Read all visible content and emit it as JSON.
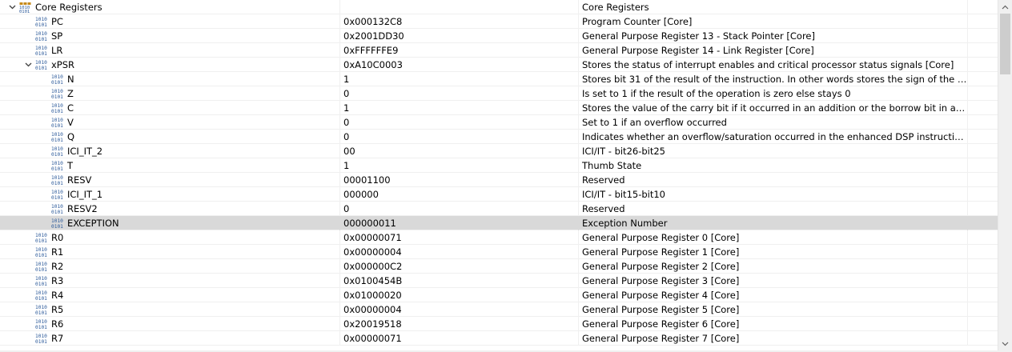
{
  "tree": {
    "rows": [
      {
        "name": "Core Registers",
        "value": "",
        "description": "Core Registers",
        "level": 0,
        "expander": "expanded",
        "icon": "register-group-icon"
      },
      {
        "name": "PC",
        "value": "0x000132C8",
        "description": "Program Counter [Core]",
        "level": 1,
        "expander": "none",
        "icon": "register-icon"
      },
      {
        "name": "SP",
        "value": "0x2001DD30",
        "description": "General Purpose Register 13 - Stack Pointer [Core]",
        "level": 1,
        "expander": "none",
        "icon": "register-icon"
      },
      {
        "name": "LR",
        "value": "0xFFFFFFE9",
        "description": "General Purpose Register 14 - Link Register [Core]",
        "level": 1,
        "expander": "none",
        "icon": "register-icon"
      },
      {
        "name": "xPSR",
        "value": "0xA10C0003",
        "description": "Stores the status of interrupt enables and critical processor status signals [Core]",
        "level": 1,
        "expander": "expanded",
        "icon": "register-icon"
      },
      {
        "name": "N",
        "value": "1",
        "description": "Stores bit 31 of the result of the instruction. In other words stores the sign of the number",
        "level": 2,
        "expander": "none",
        "icon": "register-icon"
      },
      {
        "name": "Z",
        "value": "0",
        "description": "Is set to 1 if the result of the operation is zero else stays 0",
        "level": 2,
        "expander": "none",
        "icon": "register-icon"
      },
      {
        "name": "C",
        "value": "1",
        "description": "Stores the value of the carry bit if it occurred in an addition or the borrow bit in a subtract...",
        "level": 2,
        "expander": "none",
        "icon": "register-icon"
      },
      {
        "name": "V",
        "value": "0",
        "description": "Set to 1 if an overflow occurred",
        "level": 2,
        "expander": "none",
        "icon": "register-icon"
      },
      {
        "name": "Q",
        "value": "0",
        "description": "Indicates whether an overflow/saturation occurred in the enhanced DSP instructions",
        "level": 2,
        "expander": "none",
        "icon": "register-icon"
      },
      {
        "name": "ICI_IT_2",
        "value": "00",
        "description": "ICI/IT - bit26-bit25",
        "level": 2,
        "expander": "none",
        "icon": "register-icon"
      },
      {
        "name": "T",
        "value": "1",
        "description": "Thumb State",
        "level": 2,
        "expander": "none",
        "icon": "register-icon"
      },
      {
        "name": "RESV",
        "value": "00001100",
        "description": "Reserved",
        "level": 2,
        "expander": "none",
        "icon": "register-icon"
      },
      {
        "name": "ICI_IT_1",
        "value": "000000",
        "description": "ICI/IT - bit15-bit10",
        "level": 2,
        "expander": "none",
        "icon": "register-icon"
      },
      {
        "name": "RESV2",
        "value": "0",
        "description": "Reserved",
        "level": 2,
        "expander": "none",
        "icon": "register-icon"
      },
      {
        "name": "EXCEPTION",
        "value": "000000011",
        "description": "Exception Number",
        "level": 2,
        "expander": "none",
        "icon": "register-icon",
        "selected": true
      },
      {
        "name": "R0",
        "value": "0x00000071",
        "description": "General Purpose Register 0 [Core]",
        "level": 1,
        "expander": "none",
        "icon": "register-icon"
      },
      {
        "name": "R1",
        "value": "0x00000004",
        "description": "General Purpose Register 1 [Core]",
        "level": 1,
        "expander": "none",
        "icon": "register-icon"
      },
      {
        "name": "R2",
        "value": "0x000000C2",
        "description": "General Purpose Register 2 [Core]",
        "level": 1,
        "expander": "none",
        "icon": "register-icon"
      },
      {
        "name": "R3",
        "value": "0x0100454B",
        "description": "General Purpose Register 3 [Core]",
        "level": 1,
        "expander": "none",
        "icon": "register-icon"
      },
      {
        "name": "R4",
        "value": "0x01000020",
        "description": "General Purpose Register 4 [Core]",
        "level": 1,
        "expander": "none",
        "icon": "register-icon"
      },
      {
        "name": "R5",
        "value": "0x00000004",
        "description": "General Purpose Register 5 [Core]",
        "level": 1,
        "expander": "none",
        "icon": "register-icon"
      },
      {
        "name": "R6",
        "value": "0x20019518",
        "description": "General Purpose Register 6 [Core]",
        "level": 1,
        "expander": "none",
        "icon": "register-icon"
      },
      {
        "name": "R7",
        "value": "0x00000071",
        "description": "General Purpose Register 7 [Core]",
        "level": 1,
        "expander": "none",
        "icon": "register-icon"
      }
    ]
  },
  "scrollbar": {
    "up_icon": "chevron-up-icon",
    "down_icon": "chevron-down-icon",
    "position_fraction": 0
  },
  "colors": {
    "selected_row": "#d9d9d9",
    "icon_blue": "#2c5a9a",
    "grid_line": "#f0f0f0"
  }
}
